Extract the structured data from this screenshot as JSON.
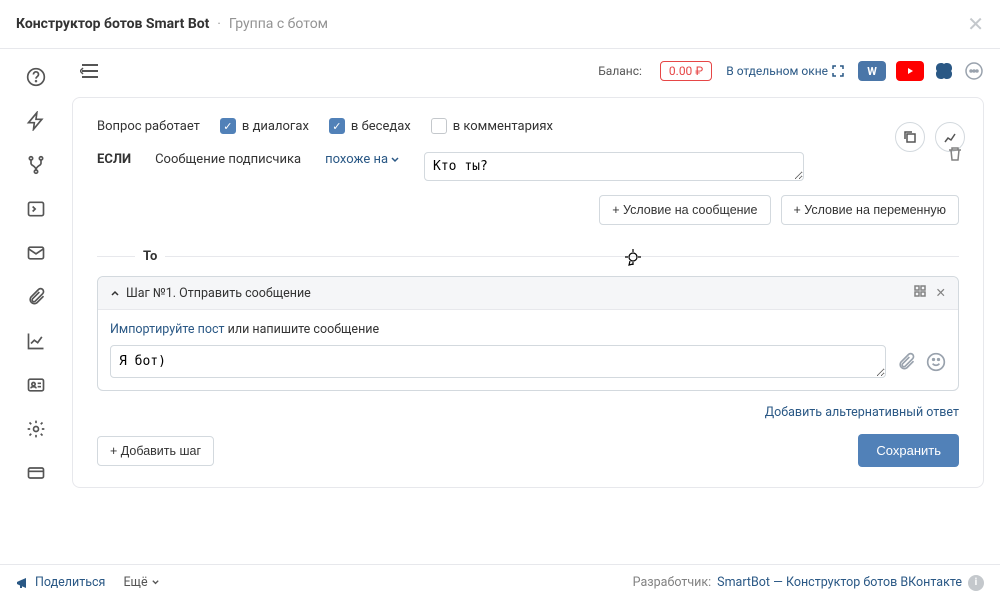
{
  "header": {
    "title": "Конструктор ботов Smart Bot",
    "separator": "·",
    "subtitle": "Группа с ботом"
  },
  "topbar": {
    "balance_label": "Баланс:",
    "balance_value": "0.00 ₽",
    "open_window": "В отдельном окне"
  },
  "card": {
    "works_label": "Вопрос работает",
    "cb_dialogs": "в диалогах",
    "cb_convos": "в беседах",
    "cb_comments": "в комментариях",
    "if_label": "ЕСЛИ",
    "sub_msg": "Сообщение подписчика",
    "like_drop": "похоже на",
    "condition_value": "Кто ты?",
    "btn_cond_msg": "+ Условие на сообщение",
    "btn_cond_var": "+ Условие на переменную",
    "then_label": "То"
  },
  "step": {
    "header": "Шаг №1. Отправить сообщение",
    "import_link": "Импортируйте пост",
    "import_tail": " или напишите сообщение",
    "message_value": "Я бот)",
    "alt_answer": "Добавить альтернативный ответ"
  },
  "actions": {
    "add_step": "+ Добавить шаг",
    "save": "Сохранить"
  },
  "footer": {
    "share": "Поделиться",
    "more": "Ещё",
    "dev_label": "Разработчик:",
    "dev_link": "SmartBot — Конструктор ботов ВКонтакте"
  }
}
